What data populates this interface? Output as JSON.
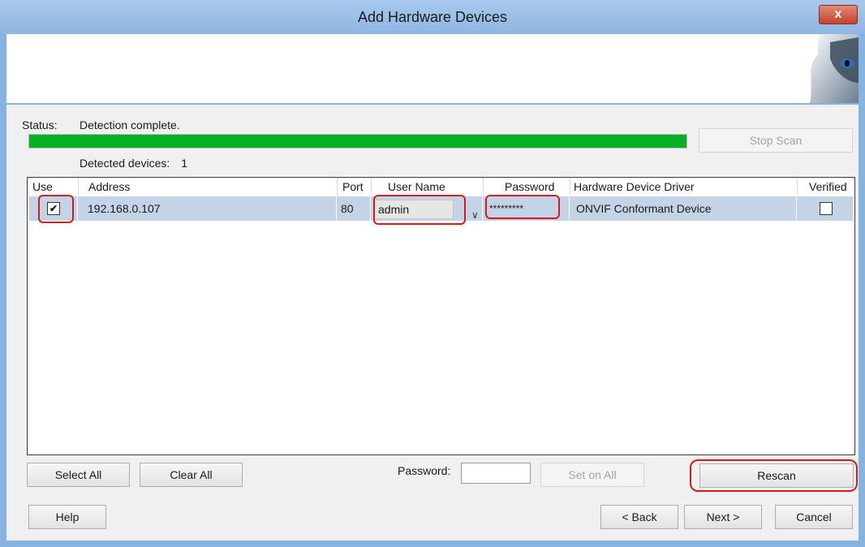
{
  "window": {
    "title": "Add Hardware Devices",
    "close_label": "x"
  },
  "status": {
    "label": "Status:",
    "value": "Detection complete.",
    "progress": 1.0,
    "progress_color": "#06b025"
  },
  "buttons": {
    "stop_scan": "Stop Scan",
    "select_all": "Select All",
    "clear_all": "Clear All",
    "set_on_all": "Set on All",
    "rescan": "Rescan",
    "help": "Help",
    "back": "< Back",
    "next": "Next >",
    "cancel": "Cancel"
  },
  "detected": {
    "label": "Detected devices:",
    "count": "1"
  },
  "table": {
    "headers": [
      "Use",
      "Address",
      "Port",
      "User Name",
      "Password",
      "Hardware Device Driver",
      "Verified"
    ],
    "rows": [
      {
        "use": true,
        "address": "192.168.0.107",
        "port": "80",
        "user_name": "admin",
        "password": "*********",
        "driver": "ONVIF Conformant Device",
        "verified": false
      }
    ]
  },
  "password_field": {
    "label": "Password:",
    "value": ""
  },
  "colors": {
    "highlight": "#d21c1c",
    "title_bar": "#8fb6e2",
    "selected_row": "#c4d4e6"
  }
}
